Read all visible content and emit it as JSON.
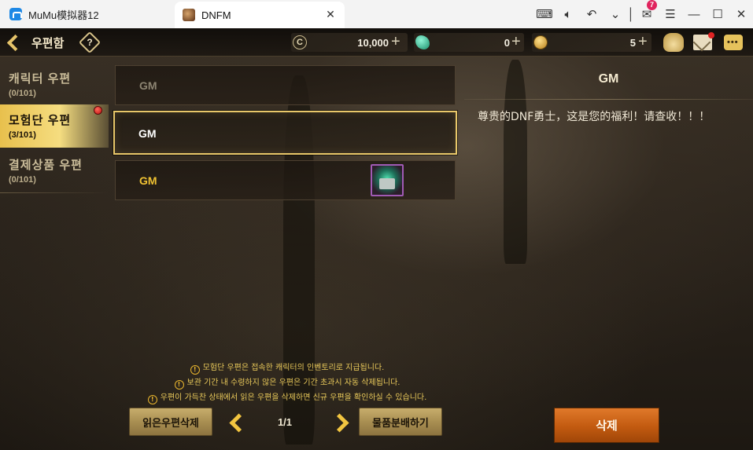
{
  "emulator": {
    "app_name": "MuMu模拟器12",
    "tab_title": "DNFM",
    "mail_badge": "7"
  },
  "topbar": {
    "title": "우편함",
    "help_symbol": "?",
    "gold": "10,000",
    "crystal": "0",
    "coin": "5",
    "plus": "+",
    "chat_icon_text": "•••"
  },
  "tabs": [
    {
      "label": "캐릭터 우편",
      "count": "(0/101)"
    },
    {
      "label": "모험단 우편",
      "count": "(3/101)"
    },
    {
      "label": "결제상품 우편",
      "count": "(0/101)"
    }
  ],
  "mails": [
    {
      "sender": "GM",
      "state": "read"
    },
    {
      "sender": "GM",
      "state": "selected"
    },
    {
      "sender": "GM",
      "state": "unread",
      "has_attachment": true
    }
  ],
  "detail": {
    "title": "GM",
    "body": "尊贵的DNF勇士，这是您的福利！请查收！！！"
  },
  "notices": [
    "모험단 우편은 접속한 캐릭터의 인벤토리로 지급됩니다.",
    "보관 기간 내 수령하지 않은 우편은 기간 초과시 자동 삭제됩니다.",
    "우편이 가득찬 상태에서 읽은 우편을 삭제하면 신규 우편을 확인하실 수 있습니다."
  ],
  "footer": {
    "delete_read_label": "읽은우편삭제",
    "page": "1/1",
    "distribute_label": "물품분배하기",
    "delete_label": "삭제"
  },
  "colors": {
    "accent_gold": "#e8c04d",
    "unread_sender": "#f0c232",
    "delete_button": "#c25a10"
  }
}
